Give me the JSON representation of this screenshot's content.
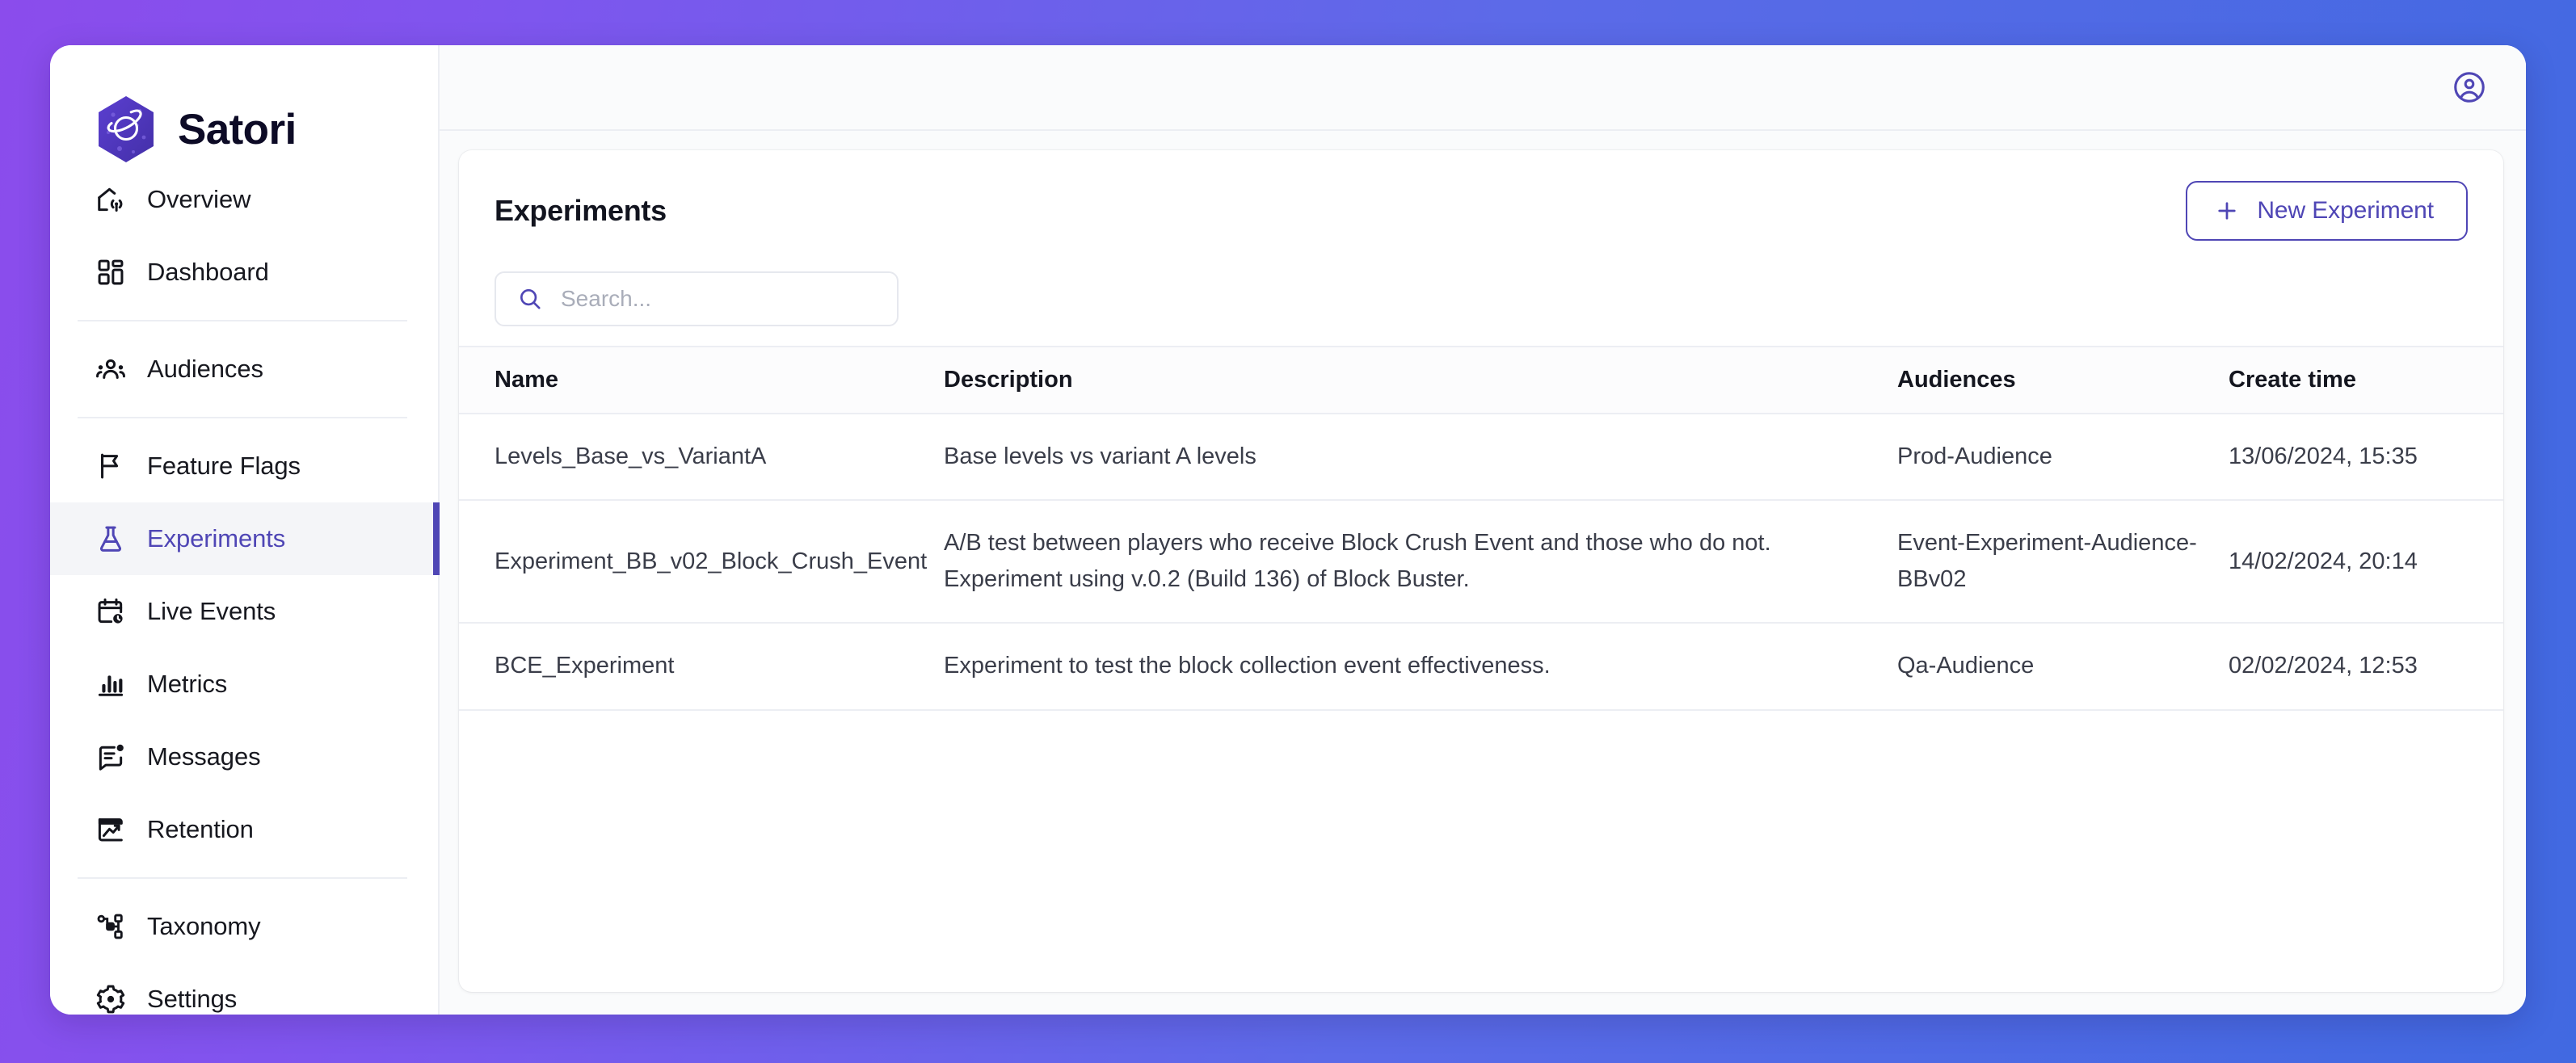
{
  "brand": {
    "name": "Satori",
    "logo_icon": "satori-planet-hexagon-logo"
  },
  "accent": {
    "purple": "#4f46b5",
    "gradient_start": "#8B4CEC",
    "gradient_end": "#4169E1"
  },
  "sidebar": {
    "items": [
      {
        "label": "Overview",
        "icon": "home-signal-icon",
        "active": false,
        "divider_after": false
      },
      {
        "label": "Dashboard",
        "icon": "grid-layout-icon",
        "active": false,
        "divider_after": true
      },
      {
        "label": "Audiences",
        "icon": "users-group-icon",
        "active": false,
        "divider_after": true
      },
      {
        "label": "Feature Flags",
        "icon": "flag-icon",
        "active": false,
        "divider_after": false
      },
      {
        "label": "Experiments",
        "icon": "flask-icon",
        "active": true,
        "divider_after": false
      },
      {
        "label": "Live Events",
        "icon": "calendar-clock-icon",
        "active": false,
        "divider_after": false
      },
      {
        "label": "Metrics",
        "icon": "bar-chart-icon",
        "active": false,
        "divider_after": false
      },
      {
        "label": "Messages",
        "icon": "message-badge-icon",
        "active": false,
        "divider_after": false
      },
      {
        "label": "Retention",
        "icon": "retention-chart-icon",
        "active": false,
        "divider_after": true
      },
      {
        "label": "Taxonomy",
        "icon": "hierarchy-icon",
        "active": false,
        "divider_after": false
      },
      {
        "label": "Settings",
        "icon": "gear-icon",
        "active": false,
        "divider_after": false
      }
    ]
  },
  "topbar": {
    "account_icon": "user-circle-icon"
  },
  "panel": {
    "title": "Experiments",
    "new_button_label": "New Experiment",
    "new_button_icon": "plus-icon"
  },
  "search": {
    "value": "",
    "placeholder": "Search...",
    "icon": "search-icon"
  },
  "table": {
    "columns": [
      "Name",
      "Description",
      "Audiences",
      "Create time",
      ""
    ],
    "row_menu_icon": "kebab-menu-icon",
    "rows": [
      {
        "name": "Levels_Base_vs_VariantA",
        "description": "Base levels vs variant A levels",
        "audiences": "Prod-Audience",
        "create_time": "13/06/2024, 15:35"
      },
      {
        "name": "Experiment_BB_v02_Block_Crush_Event",
        "description": "A/B test between players who receive Block Crush Event and those who do not. Experiment using v.0.2 (Build 136) of Block Buster.",
        "audiences": "Event-Experiment-Audience-BBv02",
        "create_time": "14/02/2024, 20:14"
      },
      {
        "name": "BCE_Experiment",
        "description": "Experiment to test the block collection event effectiveness.",
        "audiences": "Qa-Audience",
        "create_time": "02/02/2024, 12:53"
      }
    ]
  }
}
